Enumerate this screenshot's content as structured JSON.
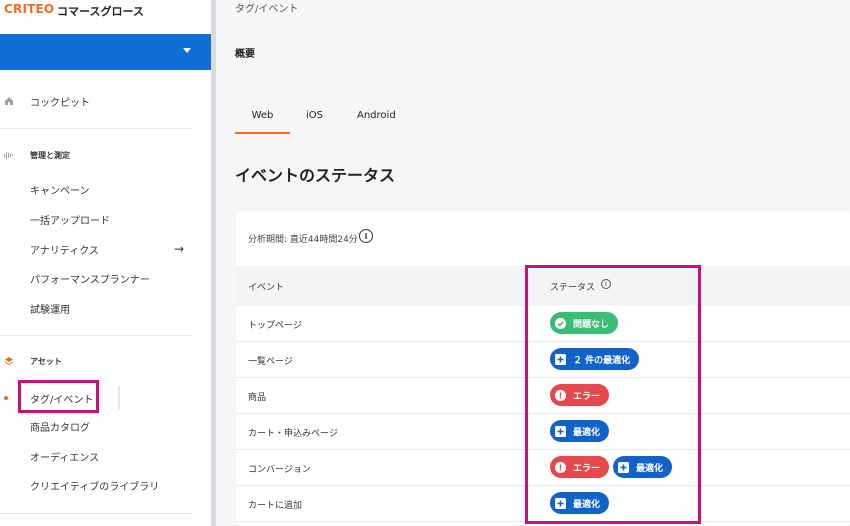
{
  "brand": {
    "logo": "CRITEO",
    "app_name": "コマースグロース"
  },
  "sidebar": {
    "cockpit": "コックピット",
    "manage_section": "管理と測定",
    "manage_items": [
      "キャンペーン",
      "一括アップロード",
      "アナリティクス",
      "パフォーマンスプランナー",
      "試験運用"
    ],
    "assets_section": "アセット",
    "assets_items": [
      "タグ/イベント",
      "商品カタログ",
      "オーディエンス",
      "クリエイティブのライブラリ"
    ],
    "active_item": "タグ/イベント"
  },
  "main": {
    "breadcrumb": "タグ/イベント",
    "section_title": "概要",
    "tabs": [
      "Web",
      "iOS",
      "Android"
    ],
    "active_tab": "Web",
    "page_heading": "イベントのステータス",
    "period": "分析期間: 直近44時間24分",
    "columns": {
      "event": "イベント",
      "status": "ステータス"
    },
    "rows": [
      {
        "event": "トップページ",
        "badges": [
          {
            "label": "問題なし",
            "kind": "ok"
          }
        ]
      },
      {
        "event": "一覧ページ",
        "badges": [
          {
            "label": "２ 件の最適化",
            "kind": "optimize"
          }
        ]
      },
      {
        "event": "商品",
        "badges": [
          {
            "label": "エラー",
            "kind": "error"
          }
        ]
      },
      {
        "event": "カート・申込みページ",
        "badges": [
          {
            "label": "最適化",
            "kind": "optimize"
          }
        ]
      },
      {
        "event": "コンバージョン",
        "badges": [
          {
            "label": "エラー",
            "kind": "error"
          },
          {
            "label": "最適化",
            "kind": "optimize"
          }
        ]
      },
      {
        "event": "カートに追加",
        "badges": [
          {
            "label": "最適化",
            "kind": "optimize"
          }
        ]
      }
    ]
  },
  "colors": {
    "brand_orange": "#f26b21",
    "account_blue": "#0f6fd6",
    "ok_green": "#3cbb74",
    "optimize_blue": "#1162c9",
    "error_red": "#e5484d",
    "highlight_magenta": "#c2137f"
  },
  "icons": [
    "home-icon",
    "chart-icon",
    "layers-icon",
    "arrow-right-icon",
    "info-icon",
    "check-icon",
    "optimize-icon",
    "error-icon",
    "chevron-down-icon"
  ]
}
